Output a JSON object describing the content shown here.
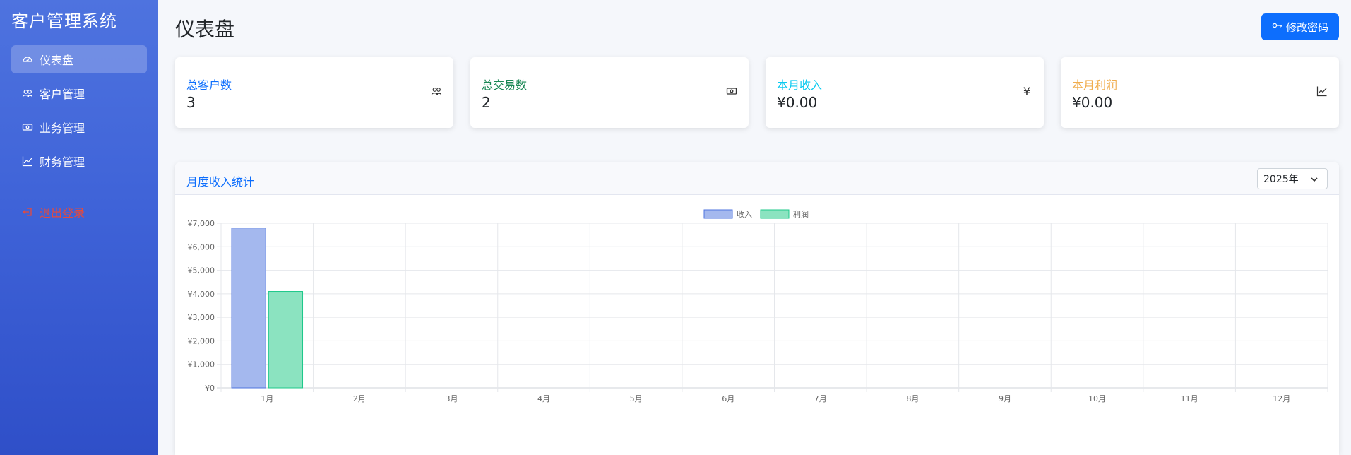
{
  "sidebar": {
    "brand": "客户管理系统",
    "items": [
      {
        "label": "仪表盘",
        "icon": "speedometer-icon",
        "active": true
      },
      {
        "label": "客户管理",
        "icon": "people-icon",
        "active": false
      },
      {
        "label": "业务管理",
        "icon": "cash-icon",
        "active": false
      },
      {
        "label": "财务管理",
        "icon": "graph-up-icon",
        "active": false
      }
    ],
    "logout": {
      "label": "退出登录",
      "icon": "box-arrow-left-icon"
    }
  },
  "header": {
    "title": "仪表盘",
    "change_password": "修改密码"
  },
  "stats": [
    {
      "label": "总客户数",
      "value": "3",
      "icon": "people-icon",
      "color": "#0d6efd"
    },
    {
      "label": "总交易数",
      "value": "2",
      "icon": "cash-icon",
      "color": "#198754"
    },
    {
      "label": "本月收入",
      "value": "¥0.00",
      "icon": "currency-yen-icon",
      "color": "#0dcaf0"
    },
    {
      "label": "本月利润",
      "value": "¥0.00",
      "icon": "graph-up-icon",
      "color": "#f0ad4e"
    }
  ],
  "chart_panel": {
    "title": "月度收入统计",
    "year": "2025年"
  },
  "chart_data": {
    "type": "bar",
    "categories": [
      "1月",
      "2月",
      "3月",
      "4月",
      "5月",
      "6月",
      "7月",
      "8月",
      "9月",
      "10月",
      "11月",
      "12月"
    ],
    "series": [
      {
        "name": "收入",
        "values": [
          6800,
          0,
          0,
          0,
          0,
          0,
          0,
          0,
          0,
          0,
          0,
          0
        ],
        "color": "#a4b8ee",
        "border": "#4e73df"
      },
      {
        "name": "利润",
        "values": [
          4100,
          0,
          0,
          0,
          0,
          0,
          0,
          0,
          0,
          0,
          0,
          0
        ],
        "color": "#8be3c0",
        "border": "#1cc88a"
      }
    ],
    "ylim": [
      0,
      7000
    ],
    "yticks": [
      0,
      1000,
      2000,
      3000,
      4000,
      5000,
      6000,
      7000
    ],
    "ytick_labels": [
      "¥0",
      "¥1,000",
      "¥2,000",
      "¥3,000",
      "¥4,000",
      "¥5,000",
      "¥6,000",
      "¥7,000"
    ],
    "legend": "top-center",
    "grid": true
  }
}
